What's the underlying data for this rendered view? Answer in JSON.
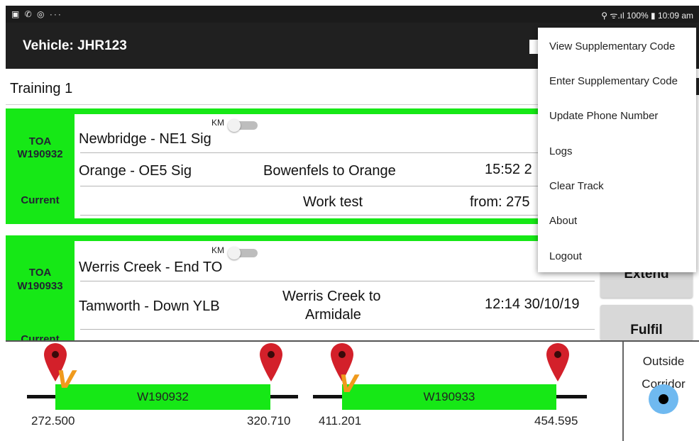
{
  "status_bar": {
    "left_icons": "▣ ✆ ◎ ···",
    "right_text": "⚲ ᯤ.ıl 100% ▮ 10:09 am"
  },
  "app_bar": {
    "title": "Vehicle: JHR123",
    "map_icon": "map-icon"
  },
  "crew_row": {
    "name": "Training 1"
  },
  "cards": [
    {
      "toa_label": "TOA",
      "toa_number": "W190932",
      "status": "Current",
      "km_label": "KM",
      "row1_location": "Newbridge - NE1 Sig",
      "row2_location": "Orange - OE5 Sig",
      "row2_route": "Bowenfels to Orange",
      "row2_time": "15:52 2",
      "row3_work": "Work test",
      "row3_from": "from: 275"
    },
    {
      "toa_label": "TOA",
      "toa_number": "W190933",
      "status": "Current",
      "km_label": "KM",
      "row1_location": "Werris Creek - End TO",
      "row2_location": "Tamworth - Down YLB",
      "row2_route_line1": "Werris Creek to",
      "row2_route_line2": "Armidale",
      "row2_time": "12:14 30/10/19"
    }
  ],
  "side_buttons": {
    "extend": "Extend",
    "fulfil": "Fulfil"
  },
  "menu": {
    "items": [
      "View Supplementary Code",
      "Enter Supplementary Code",
      "Update Phone Number",
      "Logs",
      "Clear Track",
      "About",
      "Logout"
    ]
  },
  "track": {
    "segments": [
      {
        "name": "W190932",
        "start_km": "272.500",
        "end_km": "320.710"
      },
      {
        "name": "W190933",
        "start_km": "411.201",
        "end_km": "454.595"
      }
    ],
    "vehicle_marker": "V",
    "outside_line1": "Outside",
    "outside_line2": "Corridor"
  },
  "colors": {
    "accent_green": "#16e816",
    "app_bar": "#202020",
    "pin_red": "#d3202a",
    "location_blue": "#6fb9f0",
    "marker_orange": "#f09a1c"
  }
}
